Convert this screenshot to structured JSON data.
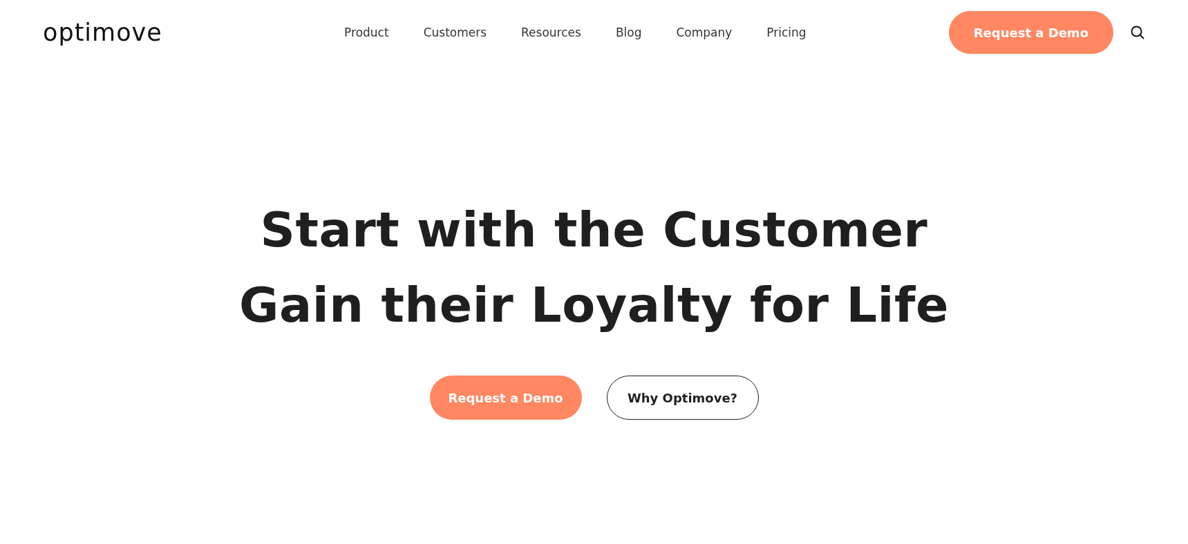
{
  "header": {
    "logo": "optimove",
    "nav": [
      {
        "label": "Product"
      },
      {
        "label": "Customers"
      },
      {
        "label": "Resources"
      },
      {
        "label": "Blog"
      },
      {
        "label": "Company"
      },
      {
        "label": "Pricing"
      }
    ],
    "cta": "Request a Demo"
  },
  "hero": {
    "headline": [
      "Start with the Customer",
      "Gain their Loyalty for Life"
    ],
    "buttons": [
      {
        "label": "Request a Demo",
        "kind": "primary"
      },
      {
        "label": "Why Optimove?",
        "kind": "outline"
      }
    ]
  }
}
